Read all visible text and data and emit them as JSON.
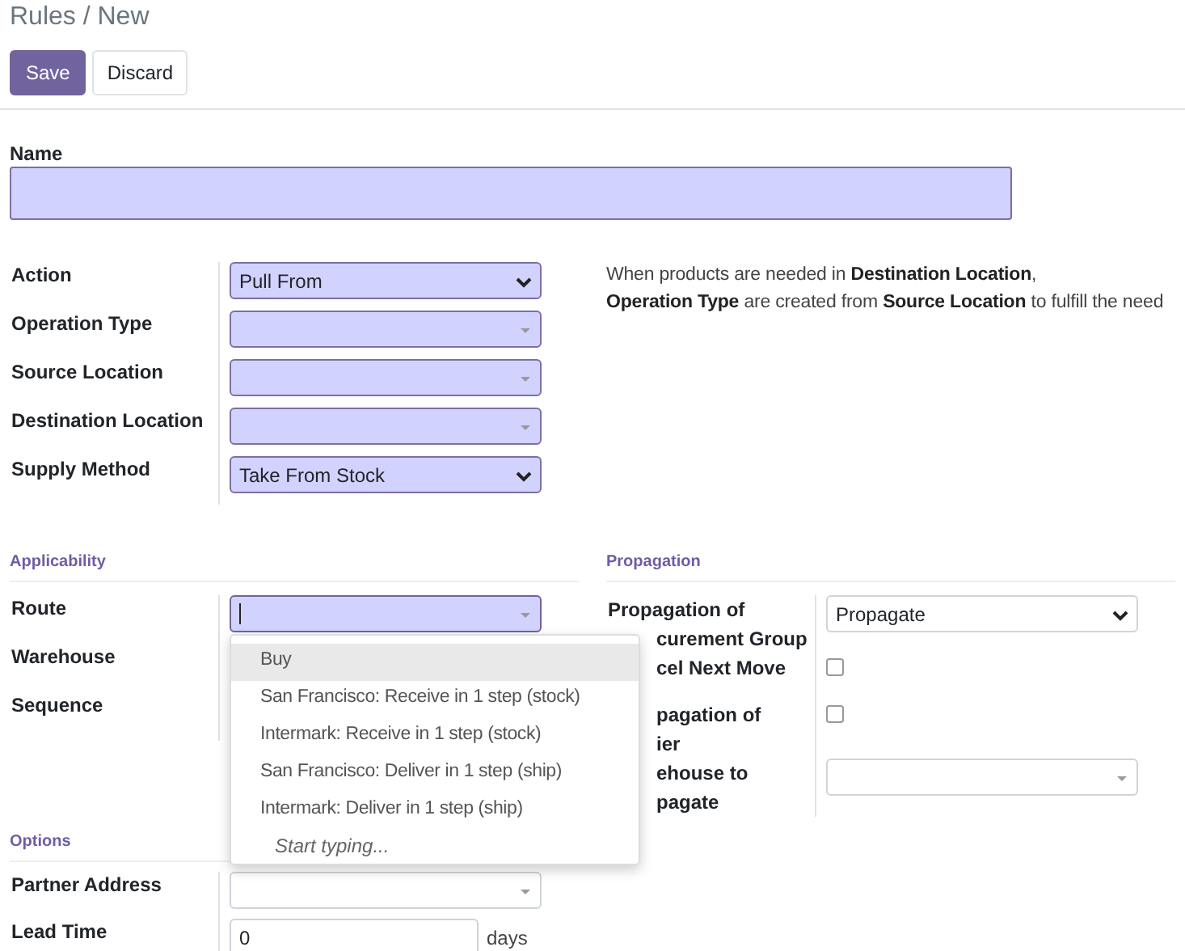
{
  "breadcrumb": "Rules / New",
  "buttons": [
    {
      "label": "Save",
      "kind": "primary"
    },
    {
      "label": "Discard",
      "kind": "secondary"
    }
  ],
  "name_field": {
    "label": "Name",
    "required": true
  },
  "main_fields": [
    {
      "label": "Action",
      "kind": "select",
      "required": true,
      "value": "Pull From"
    },
    {
      "label": "Operation Type",
      "kind": "many2one",
      "required": true
    },
    {
      "label": "Source Location",
      "kind": "many2one",
      "required": true
    },
    {
      "label": "Destination Location",
      "kind": "many2one",
      "required": true
    },
    {
      "label": "Supply Method",
      "kind": "select",
      "required": true,
      "value": "Take From Stock"
    }
  ],
  "help_lines": [
    "When products are needed in **Destination Location**,",
    "**Operation Type** are created from **Source Location** to fulfill the need"
  ],
  "applicability": {
    "title": "Applicability",
    "fields": [
      {
        "label": "Route",
        "kind": "many2one",
        "required": true,
        "focused": true
      },
      {
        "label": "Warehouse",
        "kind": "hidden"
      },
      {
        "label": "Sequence",
        "kind": "hidden"
      }
    ]
  },
  "options": {
    "title": "Options",
    "fields": [
      {
        "label": "Partner Address",
        "kind": "many2one",
        "required": false
      },
      {
        "label": "Lead Time",
        "kind": "input",
        "required": false,
        "value": "0",
        "suffix": "days"
      }
    ]
  },
  "propagation": {
    "title": "Propagation",
    "fields": [
      {
        "label_lines": [
          "Propagation of",
          "curement Group"
        ],
        "kind": "select",
        "required": false,
        "value": "Propagate"
      },
      {
        "label_lines": [
          "cel Next Move"
        ],
        "kind": "checkbox",
        "checked": false
      },
      {
        "label_lines": [
          "pagation of",
          "ier"
        ],
        "kind": "checkbox",
        "checked": false
      },
      {
        "label_lines": [
          "ehouse to",
          "pagate"
        ],
        "kind": "many2one",
        "required": false
      }
    ]
  },
  "route_dropdown": {
    "items": [
      {
        "label": "Buy",
        "selected": true
      },
      {
        "label": "San Francisco: Receive in 1 step (stock)",
        "selected": false
      },
      {
        "label": "Intermark: Receive in 1 step (stock)",
        "selected": false
      },
      {
        "label": "San Francisco: Deliver in 1 step (ship)",
        "selected": false
      },
      {
        "label": "Intermark: Deliver in 1 step (ship)",
        "selected": false
      }
    ],
    "footer": "Start typing..."
  }
}
